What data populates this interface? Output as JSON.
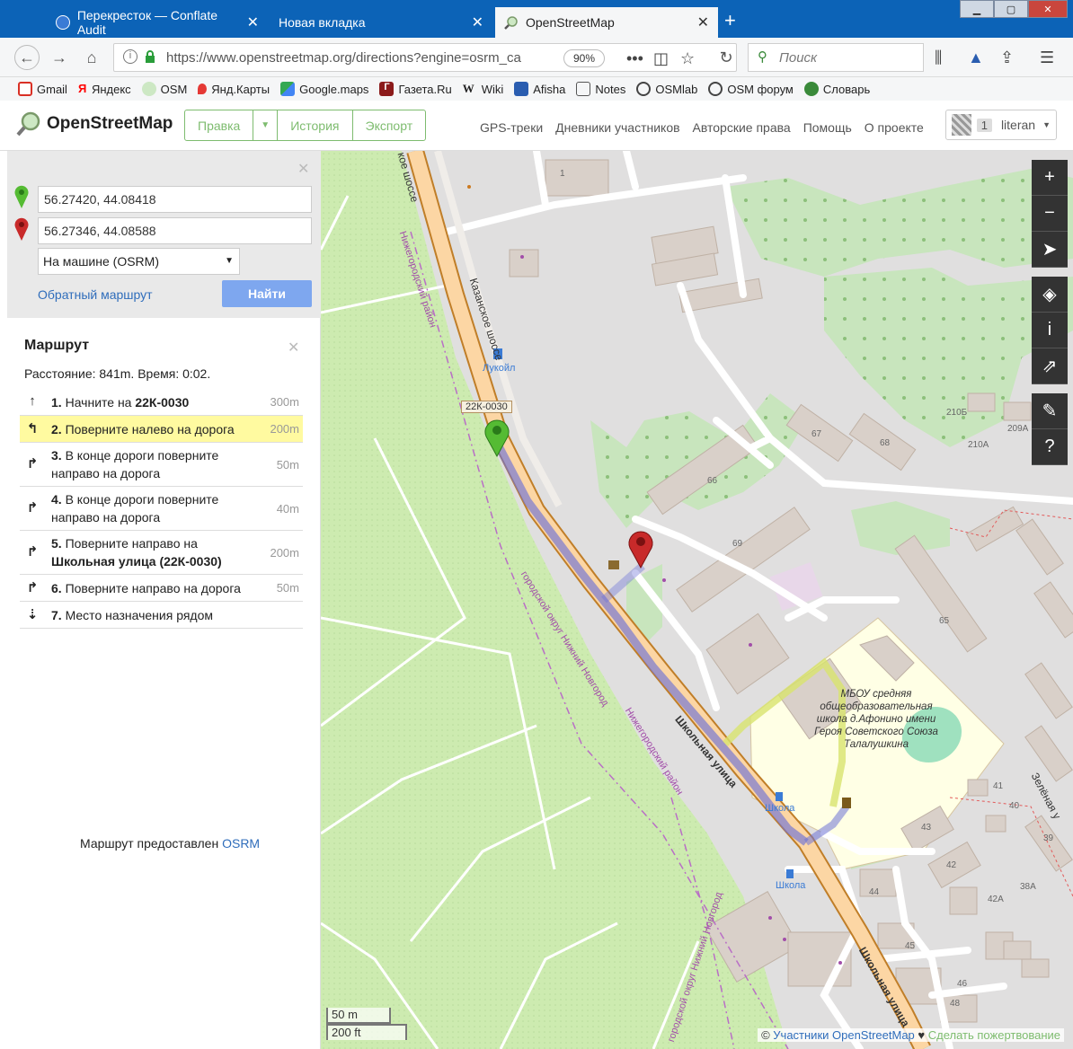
{
  "browser": {
    "tabs": [
      {
        "title": "Перекресток — Conflate Audit"
      },
      {
        "title": "Новая вкладка"
      },
      {
        "title": "OpenStreetMap"
      }
    ],
    "url": "https://www.openstreetmap.org/directions?engine=osrm_ca",
    "zoom": "90%",
    "search_placeholder": "Поиск",
    "bookmarks": [
      {
        "label": "Gmail",
        "color": "#d93025"
      },
      {
        "label": "Яндекс",
        "color": "#ff0000"
      },
      {
        "label": "OSM",
        "color": "#7ebc6f"
      },
      {
        "label": "Янд.Карты",
        "color": "#e53935"
      },
      {
        "label": "Google.maps",
        "color": "#34a853"
      },
      {
        "label": "Газета.Ru",
        "color": "#8b1a1a"
      },
      {
        "label": "Wiki",
        "color": "#333333"
      },
      {
        "label": "Afisha",
        "color": "#2a5db0"
      },
      {
        "label": "Notes",
        "color": "#555555"
      },
      {
        "label": "OSMlab",
        "color": "#444444"
      },
      {
        "label": "OSM форум",
        "color": "#444444"
      },
      {
        "label": "Словарь",
        "color": "#3a8a3a"
      }
    ]
  },
  "osm": {
    "logo": "OpenStreetMap",
    "edit": "Правка",
    "history": "История",
    "export": "Экспорт",
    "links": [
      "GPS-треки",
      "Дневники участников",
      "Авторские права",
      "Помощь",
      "О проекте"
    ],
    "user_count": "1",
    "username": "literan"
  },
  "directions": {
    "from": "56.27420, 44.08418",
    "to": "56.27346, 44.08588",
    "mode": "На машине (OSRM)",
    "reverse": "Обратный маршрут",
    "find": "Найти"
  },
  "route": {
    "title": "Маршрут",
    "summary": "Расстояние: 841m. Время: 0:02.",
    "steps": [
      {
        "num": "1.",
        "text": "Начните на",
        "bold": "22К-0030",
        "text2": "",
        "dist": "300m",
        "icon": "↑"
      },
      {
        "num": "2.",
        "text": "Поверните налево на дорога",
        "bold": "",
        "text2": "",
        "dist": "200m",
        "icon": "↰"
      },
      {
        "num": "3.",
        "text": "В конце дороги поверните",
        "bold": "",
        "text2": "направо на дорога",
        "dist": "50m",
        "icon": "↱"
      },
      {
        "num": "4.",
        "text": "В конце дороги поверните",
        "bold": "",
        "text2": "направо на дорога",
        "dist": "40m",
        "icon": "↱"
      },
      {
        "num": "5.",
        "text": "Поверните направо на",
        "bold": "Школьная улица (22К-0030)",
        "text2": "",
        "dist": "200m",
        "icon": "↱"
      },
      {
        "num": "6.",
        "text": "Поверните направо на дорога",
        "bold": "",
        "text2": "",
        "dist": "50m",
        "icon": "↱"
      },
      {
        "num": "7.",
        "text": "Место назначения рядом",
        "bold": "",
        "text2": "",
        "dist": "",
        "icon": "⇣"
      }
    ],
    "credit_prefix": "Маршрут предоставлен",
    "credit_link": "OSRM"
  },
  "map": {
    "road_labels": {
      "kazanskoe": "Казанское шоссе",
      "kazanskoe_top": "кое шоссе",
      "shkolnaya": "Школьная улица",
      "shkolnaya2": "Школьная улица",
      "zelenaya": "Зелёная у",
      "ref": "22К-0030",
      "district1": "Нижегородский район",
      "district2": "городской округ Нижний Новгород",
      "district3": "Нижегородский район",
      "district4": "городской округ Нижний Новгород"
    },
    "poi": {
      "lukoil": "Лукойл",
      "school_stop1": "Школа",
      "school_stop2": "Школа",
      "school": "МБОУ средняя общеобразовательная школа д.Афонино имени Героя Советского Союза Талалушкина"
    },
    "houses": [
      "1",
      "67",
      "68",
      "66",
      "69",
      "65",
      "210Б",
      "210А",
      "209А",
      "41",
      "40",
      "43",
      "42",
      "39",
      "44",
      "42А",
      "38А",
      "45",
      "46",
      "48"
    ],
    "scale_m": "50 m",
    "scale_ft": "200 ft",
    "attribution_prefix": "©",
    "attribution_link": "Участники OpenStreetMap",
    "attribution_sep": "♥",
    "donate": "Сделать пожертвование",
    "colors": {
      "background": "#e0dfdf",
      "park": "#c8facc",
      "wood": "#add19e",
      "building": "#d9d0c9",
      "trunk": "#fcd6a4",
      "trunk_casing": "#c07e28",
      "route": "#6e72d6",
      "school": "#ffffe5"
    }
  }
}
